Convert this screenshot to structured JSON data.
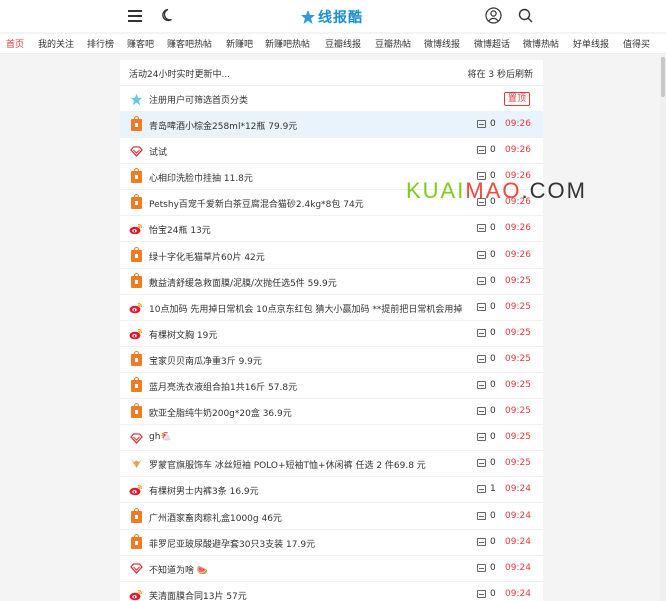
{
  "header": {
    "logo_text": "线报酷",
    "menu_icon": "menu-icon",
    "theme_icon": "moon-icon",
    "user_icon": "user-icon",
    "search_icon": "search-icon",
    "brand_color": "#1a8fd6"
  },
  "nav": {
    "items": [
      "首页",
      "我的关注",
      "排行榜",
      "赚客吧",
      "赚客吧热帖",
      "新赚吧",
      "新赚吧热帖",
      "豆瓣线报",
      "豆瓣热帖",
      "微博线报",
      "微博超话",
      "微博热帖",
      "好单线报",
      "值得买"
    ],
    "active": "首页",
    "active_color": "#e4393c"
  },
  "feed": {
    "status_text": "活动24小时实时更新中...",
    "refresh_text": "将在 3 秒后刷新",
    "pinned_title": "注册用户可筛选首页分类",
    "pinned_badge": "置顶",
    "items": [
      {
        "icon": "shop",
        "title": "青岛啤酒小棕金258ml*12瓶 79.9元",
        "comments": "0",
        "time": "09:26",
        "highlight": true
      },
      {
        "icon": "diamond",
        "title": "试试",
        "comments": "0",
        "time": "09:26"
      },
      {
        "icon": "shop",
        "title": "心相印洗脸巾挂抽 11.8元",
        "comments": "0",
        "time": "09:26"
      },
      {
        "icon": "shop",
        "title": "Petshy百宠千爱新白茶豆腐混合猫砂2.4kg*8包 74元",
        "comments": "0",
        "time": "09:26"
      },
      {
        "icon": "weibo",
        "title": "怡宝24瓶 13元",
        "comments": "0",
        "time": "09:26"
      },
      {
        "icon": "shop",
        "title": "绿十字化毛猫草片60片 42元",
        "comments": "0",
        "time": "09:26"
      },
      {
        "icon": "shop",
        "title": "敷益清舒缓急救面膜/泥膜/次抛任选5件 59.9元",
        "comments": "0",
        "time": "09:25"
      },
      {
        "icon": "weibo",
        "title": "10点加码 先用掉日常机会 10点京东红包 猜大小赢加码 **提前把日常机会用掉",
        "comments": "0",
        "time": "09:25"
      },
      {
        "icon": "weibo",
        "title": "有棵树文胸 19元",
        "comments": "0",
        "time": "09:25"
      },
      {
        "icon": "shop",
        "title": "宝家贝贝南瓜净重3斤 9.9元",
        "comments": "0",
        "time": "09:25"
      },
      {
        "icon": "shop",
        "title": "蓝月亮洗衣液组合拍1共16斤 57.8元",
        "comments": "0",
        "time": "09:25"
      },
      {
        "icon": "shop",
        "title": "欧亚全脂纯牛奶200g*20盒 36.9元",
        "comments": "0",
        "time": "09:25"
      },
      {
        "icon": "diamond",
        "title": "gh🐔",
        "comments": "0",
        "time": "09:25"
      },
      {
        "icon": "fox",
        "title": "罗蒙官旗服饰车 冰丝短袖 POLO+短袖T恤+休闲裤 任选 2 件69.8 元",
        "comments": "0",
        "time": "09:25"
      },
      {
        "icon": "weibo",
        "title": "有棵树男士内裤3条 16.9元",
        "comments": "1",
        "time": "09:24"
      },
      {
        "icon": "shop",
        "title": "广州酒家畜肉粽礼盒1000g 46元",
        "comments": "0",
        "time": "09:24"
      },
      {
        "icon": "shop",
        "title": "菲罗尼亚玻尿酸避孕套30只3支装 17.9元",
        "comments": "0",
        "time": "09:24"
      },
      {
        "icon": "diamond",
        "title": "不知道为啥 🍉",
        "comments": "0",
        "time": "09:24"
      },
      {
        "icon": "weibo",
        "title": "芙清面膜合同13片 57元",
        "comments": "0",
        "time": "09:24"
      }
    ],
    "time_color": "#e4393c",
    "highlight_color": "#e8f3fc"
  },
  "watermark": {
    "part1": "KUAI",
    "part2": "MAO",
    "part3": ".COM"
  }
}
